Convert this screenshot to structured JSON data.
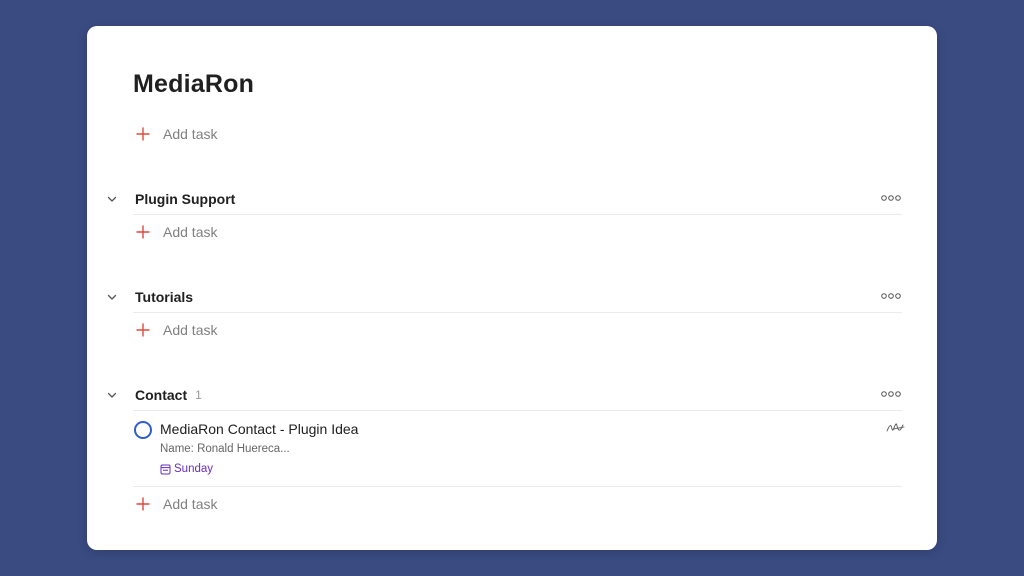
{
  "project": {
    "title": "MediaRon",
    "add_task_label": "Add task"
  },
  "sections": [
    {
      "name": "Plugin Support",
      "count": "",
      "add_task_label": "Add task"
    },
    {
      "name": "Tutorials",
      "count": "",
      "add_task_label": "Add task"
    },
    {
      "name": "Contact",
      "count": "1",
      "add_task_label": "Add task"
    }
  ],
  "task": {
    "title": "MediaRon Contact - Plugin Idea",
    "description": "Name: Ronald Huereca...",
    "due": "Sunday"
  },
  "icons": {
    "add": "plus-icon",
    "collapse": "chevron-down-icon",
    "more": "more-options-icon",
    "due": "calendar-icon",
    "assignee": "assignee-signature-icon"
  },
  "colors": {
    "background": "#3a4b82",
    "accent_add": "#dc4c3e",
    "checkbox": "#2f5fc9",
    "due_date": "#692fc2"
  }
}
